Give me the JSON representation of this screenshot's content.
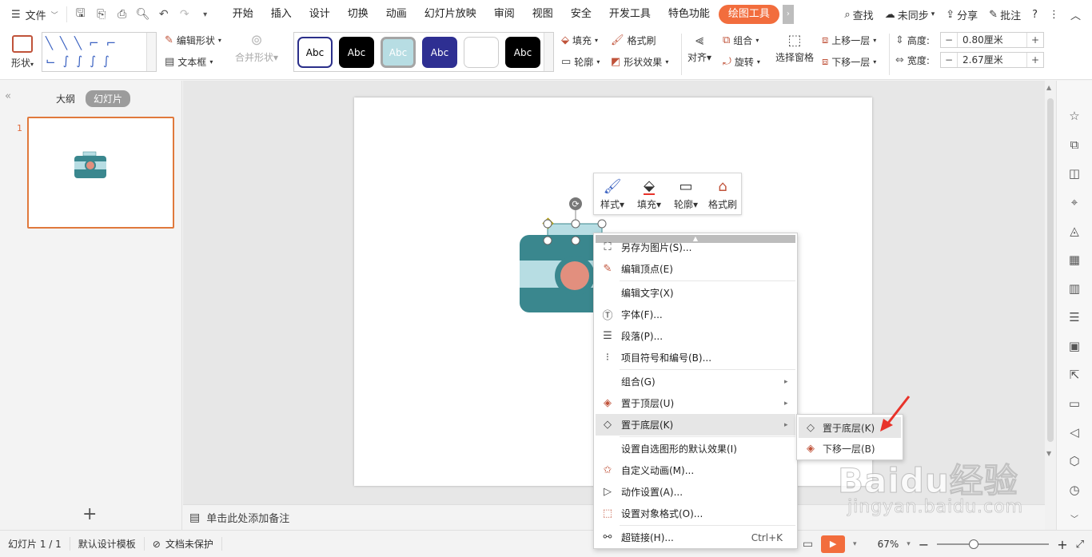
{
  "menubar": {
    "file_label": "文件",
    "tabs": [
      "开始",
      "插入",
      "设计",
      "切换",
      "动画",
      "幻灯片放映",
      "审阅",
      "视图",
      "安全",
      "开发工具",
      "特色功能",
      "绘图工具"
    ],
    "search": "查找",
    "sync": "未同步",
    "share": "分享",
    "comment": "批注"
  },
  "ribbon": {
    "shape": "形状",
    "edit_shape": "编辑形状",
    "text_box": "文本框",
    "merge_shape": "合并形状",
    "style_swatches": [
      {
        "label": "Abc",
        "bg": "#ffffff",
        "fg": "#000000",
        "border": "#2b2f8a"
      },
      {
        "label": "Abc",
        "bg": "#000000",
        "fg": "#ffffff",
        "border": "#000000"
      },
      {
        "label": "Abc",
        "bg": "#b7dde3",
        "fg": "#ffffff",
        "border": "#9a9a9a"
      },
      {
        "label": "Abc",
        "bg": "#2e2f92",
        "fg": "#ffffff",
        "border": "#2e2f92"
      },
      {
        "label": "",
        "bg": "#ffffff",
        "fg": "#000000",
        "border": "#cccccc"
      },
      {
        "label": "Abc",
        "bg": "#000000",
        "fg": "#ffffff",
        "border": "#000000"
      }
    ],
    "fill": "填充",
    "format_painter": "格式刷",
    "outline": "轮廓",
    "shape_effect": "形状效果",
    "align": "对齐",
    "group": "组合",
    "rotate": "旋转",
    "selection_pane": "选择窗格",
    "bring_forward": "上移一层",
    "send_backward": "下移一层",
    "height_label": "高度:",
    "height_value": "0.80厘米",
    "width_label": "宽度:",
    "width_value": "2.67厘米"
  },
  "leftpanel": {
    "outline_tab": "大纲",
    "slides_tab": "幻灯片",
    "slide_number": "1"
  },
  "notes_placeholder": "单击此处添加备注",
  "minibar": {
    "style": "样式",
    "fill": "填充",
    "outline": "轮廓",
    "format_painter": "格式刷"
  },
  "context_menu": {
    "save_as_picture": "另存为图片(S)...",
    "edit_points": "编辑顶点(E)",
    "edit_text": "编辑文字(X)",
    "font": "字体(F)...",
    "paragraph": "段落(P)...",
    "bullets": "项目符号和编号(B)...",
    "group": "组合(G)",
    "bring_to_front": "置于顶层(U)",
    "send_to_back": "置于底层(K)",
    "set_default": "设置自选图形的默认效果(I)",
    "custom_animation": "自定义动画(M)...",
    "action_settings": "动作设置(A)...",
    "format_object": "设置对象格式(O)...",
    "hyperlink": "超链接(H)...",
    "hyperlink_shortcut": "Ctrl+K"
  },
  "submenu": {
    "send_to_back": "置于底层(K)",
    "send_backward": "下移一层(B)"
  },
  "statusbar": {
    "slide_count": "幻灯片 1 / 1",
    "template": "默认设计模板",
    "protect": "文档未保护",
    "zoom": "67%"
  },
  "watermark": {
    "logo": "Baidu经验",
    "url": "jingyan.baidu.com"
  },
  "colors": {
    "accent": "#f26d3d",
    "teal": "#3a878e",
    "light_teal": "#b7dde3",
    "coral": "#e28f7e",
    "arrow_red": "#e8332a"
  }
}
